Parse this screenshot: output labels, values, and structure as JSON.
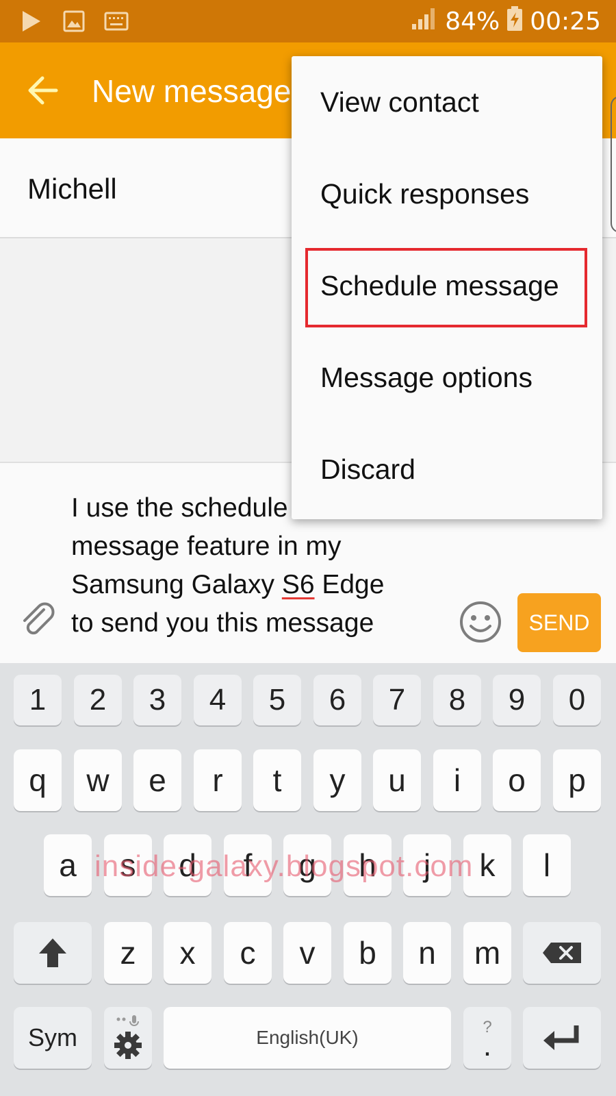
{
  "status_bar": {
    "battery": "84%",
    "time": "00:25",
    "icons": [
      "play-icon",
      "image-icon",
      "keyboard-icon",
      "signal-icon",
      "battery-charging-icon"
    ]
  },
  "app_bar": {
    "title": "New message",
    "back_icon": "back-arrow-icon"
  },
  "recipient": {
    "name": "Michell"
  },
  "compose": {
    "line1": "I use the schedule",
    "line2": "message feature in my",
    "line3_before": "Samsung Galaxy ",
    "line3_misspelled": "S6",
    "line3_after": " Edge",
    "line4": "to send you this message",
    "send_label": "SEND",
    "attach_icon": "paperclip-icon",
    "emoji_icon": "smiley-icon"
  },
  "menu": {
    "items": [
      {
        "label": "View contact"
      },
      {
        "label": "Quick responses"
      },
      {
        "label": "Schedule message"
      },
      {
        "label": "Message options"
      },
      {
        "label": "Discard"
      }
    ],
    "highlighted_index": 2,
    "highlight_color": "#e5292f"
  },
  "keyboard": {
    "number_row": [
      "1",
      "2",
      "3",
      "4",
      "5",
      "6",
      "7",
      "8",
      "9",
      "0"
    ],
    "row1": [
      "q",
      "w",
      "e",
      "r",
      "t",
      "y",
      "u",
      "i",
      "o",
      "p"
    ],
    "row2": [
      "a",
      "s",
      "d",
      "f",
      "g",
      "h",
      "j",
      "k",
      "l"
    ],
    "row3": [
      "z",
      "x",
      "c",
      "v",
      "b",
      "n",
      "m"
    ],
    "sym_label": "Sym",
    "space_label": "English(UK)",
    "period_label": ".",
    "period_hint": "?",
    "shift_icon": "shift-icon",
    "backspace_icon": "backspace-icon",
    "enter_icon": "enter-icon",
    "settings_icon": "gear-icon"
  },
  "watermark": "inside-galaxy.blogspot.com",
  "colors": {
    "status_bar": "#cf7706",
    "app_bar": "#f29c00",
    "send_button": "#f7a21f"
  }
}
